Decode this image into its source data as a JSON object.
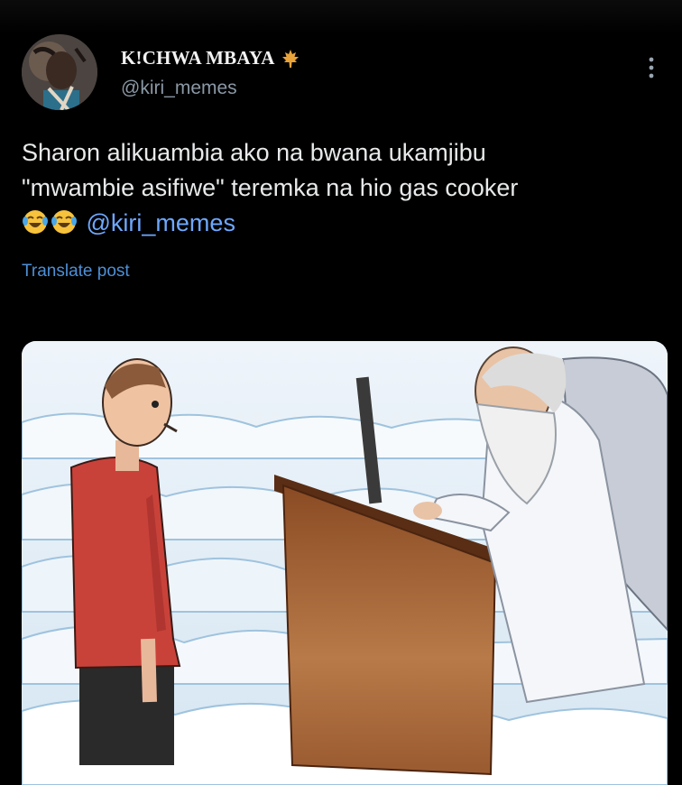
{
  "post": {
    "author": {
      "display_name": "K!CHWA MBAYA",
      "badge_icon": "maple-leaf-icon",
      "handle": "@kiri_memes"
    },
    "text_line1": "Sharon alikuambia ako na bwana ukamjibu",
    "text_line2": "\"mwambie asifiwe\" teremka na hio gas cooker",
    "emojis": [
      "face-with-tears-of-joy-icon",
      "face-with-tears-of-joy-icon"
    ],
    "mention": "@kiri_memes",
    "translate_label": "Translate post",
    "more_icon": "more-vertical-icon",
    "media_icon": "cartoon-image",
    "colors": {
      "background": "#000000",
      "text": "#e7e9ea",
      "secondary_text": "#8b98a5",
      "link": "#4d8fd6",
      "mention": "#6ea8fe",
      "badge": "#e8a33b"
    }
  }
}
